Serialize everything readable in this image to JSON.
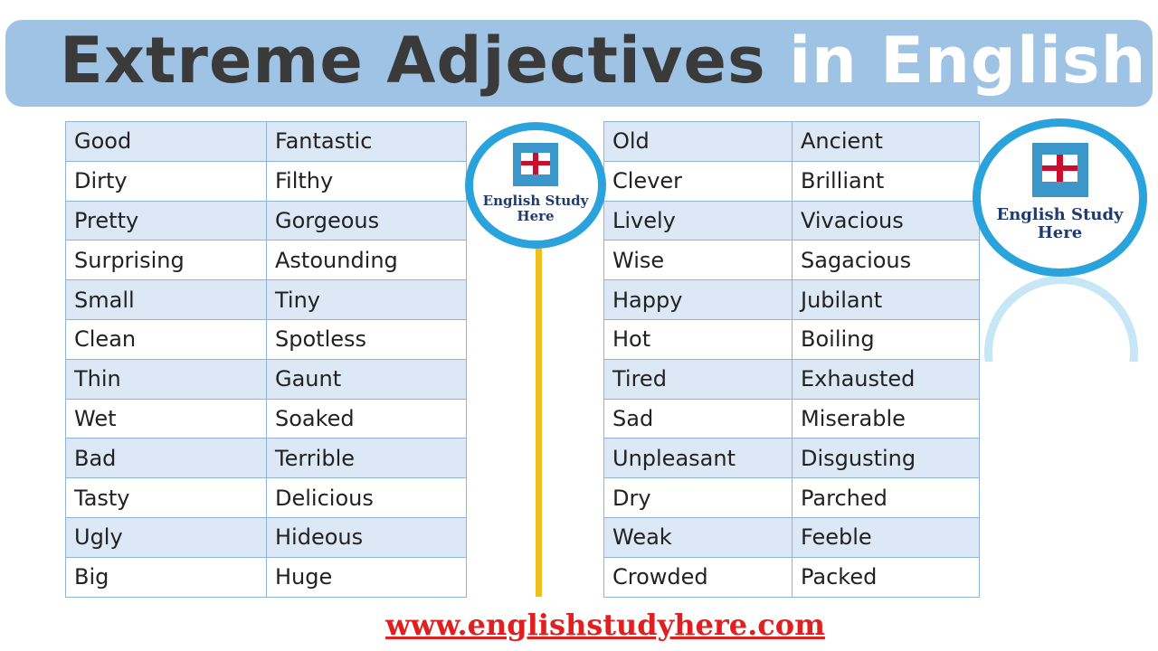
{
  "title": {
    "part1": "Extreme Adjectives",
    "part2": "in English"
  },
  "left_table": [
    [
      "Good",
      "Fantastic"
    ],
    [
      "Dirty",
      "Filthy"
    ],
    [
      "Pretty",
      "Gorgeous"
    ],
    [
      "Surprising",
      "Astounding"
    ],
    [
      "Small",
      "Tiny"
    ],
    [
      "Clean",
      "Spotless"
    ],
    [
      "Thin",
      "Gaunt"
    ],
    [
      "Wet",
      "Soaked"
    ],
    [
      "Bad",
      "Terrible"
    ],
    [
      "Tasty",
      "Delicious"
    ],
    [
      "Ugly",
      "Hideous"
    ],
    [
      "Big",
      "Huge"
    ]
  ],
  "right_table": [
    [
      "Old",
      "Ancient"
    ],
    [
      "Clever",
      "Brilliant"
    ],
    [
      "Lively",
      "Vivacious"
    ],
    [
      "Wise",
      "Sagacious"
    ],
    [
      "Happy",
      "Jubilant"
    ],
    [
      "Hot",
      "Boiling"
    ],
    [
      "Tired",
      "Exhausted"
    ],
    [
      "Sad",
      "Miserable"
    ],
    [
      "Unpleasant",
      "Disgusting"
    ],
    [
      "Dry",
      "Parched"
    ],
    [
      "Weak",
      "Feeble"
    ],
    [
      "Crowded",
      "Packed"
    ]
  ],
  "logo": {
    "line1": "English Study",
    "line2": "Here"
  },
  "url": "www.englishstudyhere.com",
  "colors": {
    "banner": "#9fc3e5",
    "row_alt": "#dce8f5",
    "logo_ring": "#2aa2dc",
    "pole": "#f0c01c",
    "url": "#e02020"
  }
}
